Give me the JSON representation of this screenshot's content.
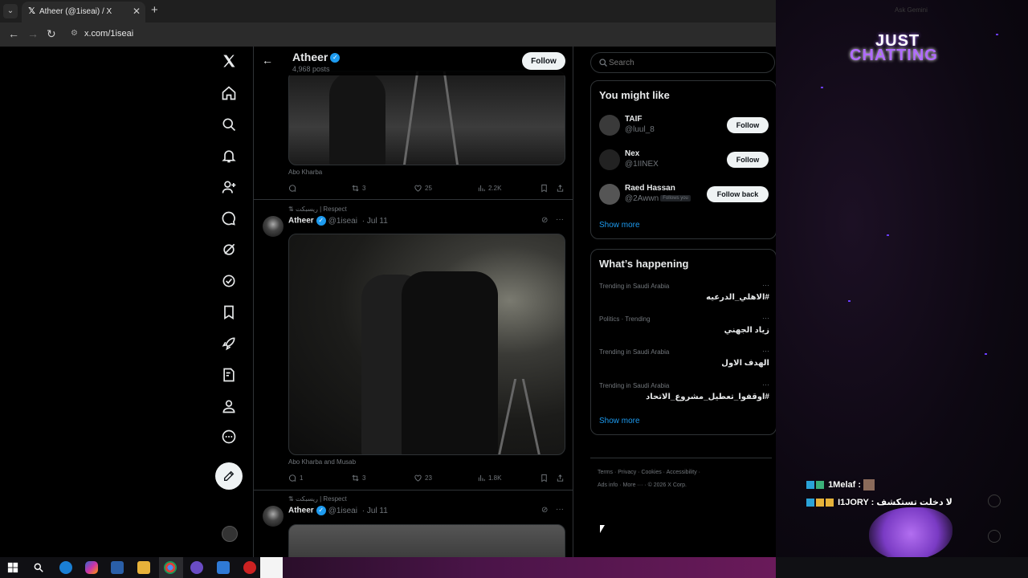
{
  "browser": {
    "tab_title": "Atheer (@1iseai) / X",
    "url": "x.com/1iseai",
    "new_tab": "+",
    "tab_close": "✕"
  },
  "profile": {
    "name": "Atheer",
    "posts_count": "4,968 posts",
    "follow_label": "Follow"
  },
  "posts": [
    {
      "caption": "Abo Kharba",
      "replies": "",
      "reposts": "3",
      "likes": "25",
      "views": "2.2K"
    },
    {
      "repost_by": "ريسبكت | Respect",
      "author": "Atheer",
      "handle": "@1iseai",
      "date": "· Jul 11",
      "caption": "Abo Kharba and Musab",
      "replies": "1",
      "reposts": "3",
      "likes": "23",
      "views": "1.8K"
    },
    {
      "repost_by": "ريسبكت | Respect",
      "author": "Atheer",
      "handle": "@1iseai",
      "date": "· Jul 11"
    }
  ],
  "search": {
    "placeholder": "Search"
  },
  "you_might_like": {
    "title": "You might like",
    "users": [
      {
        "name": "TAIF",
        "handle": "@luul_8",
        "button": "Follow"
      },
      {
        "name": "Nex",
        "handle": "@1IINEX",
        "button": "Follow"
      },
      {
        "name": "Raed Hassan",
        "handle": "@2Awwn",
        "badge": "Follows you",
        "button": "Follow back"
      }
    ],
    "show_more": "Show more"
  },
  "whats_happening": {
    "title": "What’s happening",
    "trends": [
      {
        "meta": "Trending in Saudi Arabia",
        "name": "#الاهلي_الدرعيه"
      },
      {
        "meta": "Politics · Trending",
        "name": "زياد الجهني"
      },
      {
        "meta": "Trending in Saudi Arabia",
        "name": "الهدف الاول"
      },
      {
        "meta": "Trending in Saudi Arabia",
        "name": "#اوقفوا_تعطيل_مشروع_الاتحاد"
      }
    ],
    "show_more": "Show more"
  },
  "footer": {
    "line1": "Terms  ·  Privacy  ·  Cookies  ·  Accessibility  ·",
    "line2": "Ads info  ·  More ···  ·  © 2026 X Corp."
  },
  "stream": {
    "gemini": "Ask Gemini",
    "title_top": "JUST",
    "title_bottom": "CHATTING",
    "chat": [
      {
        "text": "1Melaf :"
      },
      {
        "text": "I1JORY : لا دخلت تستكشف"
      }
    ]
  },
  "icons": {
    "nav": [
      "x-logo-icon",
      "home-icon",
      "search-icon",
      "bell-icon",
      "add-user-icon",
      "grok-chat-icon",
      "grok-icon",
      "verified-icon",
      "bookmark-icon",
      "rocket-icon",
      "edit-list-icon",
      "profile-icon",
      "more-icon",
      "compose-icon"
    ]
  },
  "colors": {
    "accent": "#1d9bf0",
    "background": "#000000",
    "text": "#e7e9ea",
    "muted": "#71767b",
    "stream_purple": "#b06bff"
  }
}
